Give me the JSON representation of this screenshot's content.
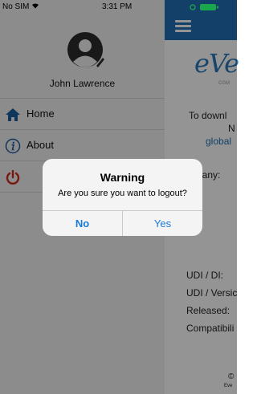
{
  "status_bar": {
    "carrier": "No SIM",
    "time": "3:31 PM"
  },
  "drawer": {
    "user_name": "John Lawrence",
    "items": [
      {
        "label": "Home",
        "icon": "home-icon"
      },
      {
        "label": "About",
        "icon": "info-icon"
      },
      {
        "label": "",
        "icon": "power-icon"
      }
    ]
  },
  "background": {
    "logo_text": "eVe",
    "logo_sub": "CGM",
    "download_text": "To downl",
    "n_text": "N",
    "link_text": "global",
    "company_text": "pany:",
    "udi_di": "UDI / DI:",
    "udi_version": "UDI / Versic",
    "released": "Released:",
    "compatibility": "Compatibili",
    "copyright": "©",
    "footer_small": "Eve"
  },
  "alert": {
    "title": "Warning",
    "message": "Are you sure you want to logout?",
    "no_label": "No",
    "yes_label": "Yes"
  },
  "colors": {
    "accent": "#1f6fb3",
    "button_text": "#1a7ad9",
    "power_icon": "#cc2a1a"
  }
}
